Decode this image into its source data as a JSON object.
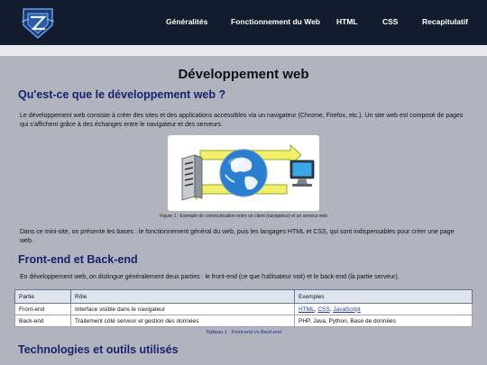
{
  "nav": {
    "items": [
      {
        "label": "Généralités"
      },
      {
        "label": "Fonctionnement du Web"
      },
      {
        "label": "HTML"
      },
      {
        "label": "CSS"
      },
      {
        "label": "Recapitulatif"
      }
    ]
  },
  "main": {
    "title": "Développement web",
    "sections": [
      {
        "heading": "Qu'est-ce que le développement web ?",
        "paragraph": "Le développement web consiste à créer des sites et des applications accessibles via un navigateur (Chrome, Firefox, etc.). Un site web est composé de pages qui s'affichent grâce à des échanges entre le navigateur et des serveurs.",
        "figure_caption": "Figure 1 : Exemple de communication entre un client (navigateur) et un serveur web",
        "paragraph2": "Dans ce mini-site, on présente les bases : le fonctionnement général du web, puis les langages HTML et CSS, qui sont indispensables pour créer une page web."
      },
      {
        "heading": "Front-end et Back-end",
        "paragraph": "En développement web, on distingue généralement deux parties : le front-end (ce que l'utilisateur voit) et le back-end (la partie serveur)."
      },
      {
        "heading": "Technologies et outils utilisés"
      }
    ],
    "table": {
      "headers": [
        "Partie",
        "Rôle",
        "Exemples"
      ],
      "rows": [
        {
          "part": "Front-end",
          "role": "Interface visible dans le navigateur",
          "links": [
            "HTML",
            "CSS",
            "JavaScript"
          ]
        },
        {
          "part": "Back-end",
          "role": "Traitement côté serveur et gestion des données",
          "examples": "PHP, Java, Python, Base de données"
        }
      ],
      "caption": "Tableau 1 : Front-end vs Back-end"
    }
  },
  "colors": {
    "navbar": "#121c2e",
    "background": "#b1b4bf",
    "heading": "#17236a",
    "link": "#1a3aa8"
  },
  "icons": [
    "logo-shield-icon",
    "server-icon",
    "globe-icon",
    "monitor-icon",
    "arrow-icon"
  ]
}
